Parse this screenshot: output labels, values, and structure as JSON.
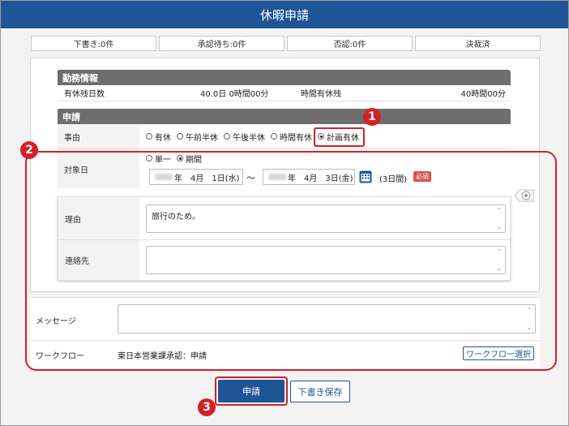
{
  "title": "休暇申請",
  "tabs": [
    "下書き:0件",
    "承認待ち:0件",
    "否認:0件",
    "決裁済"
  ],
  "work_info": {
    "header": "勤務情報",
    "label1": "有休残日数",
    "value1": "40.0日 0時間00分",
    "label2": "時間有休残",
    "value2": "40時間00分"
  },
  "request": {
    "header": "申請",
    "reason_type_label": "事由",
    "reason_options": [
      "有休",
      "午前半休",
      "午後半休",
      "時間有休",
      "計画有休"
    ],
    "selected_option": "計画有休",
    "target_date_label": "対象日",
    "date_mode_options": [
      "単一",
      "期間"
    ],
    "selected_mode": "期間",
    "start_date": "年　4月　1日(水)",
    "tilde": "～",
    "end_date": "年　4月　3日(金)",
    "days": "(3日間)",
    "required": "必須",
    "reason_label": "理由",
    "reason_text": "旅行のため。",
    "contact_label": "連絡先",
    "contact_text": ""
  },
  "message_label": "メッセージ",
  "workflow_label": "ワークフロー",
  "workflow_value": "東日本営業課承認：申請",
  "workflow_button": "ワークフロー選択",
  "submit_button": "申請",
  "draft_button": "下書き保存",
  "callouts": [
    "1",
    "2",
    "3"
  ],
  "colors": {
    "brand": "#1f5597",
    "callout": "#d42027",
    "section_header": "#6e6e6e"
  }
}
